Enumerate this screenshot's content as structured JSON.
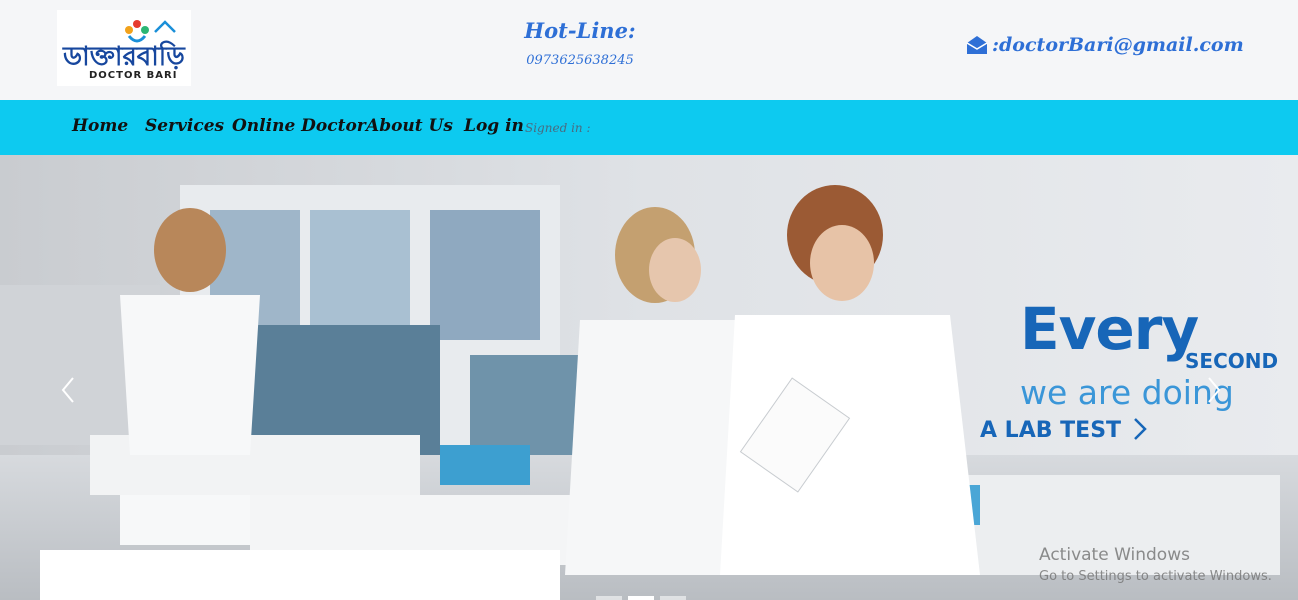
{
  "header": {
    "logo_text_bn": "ডাক্তারবাড়ি",
    "logo_text_en": "DOCTOR BARI",
    "hotline_title": "Hot-Line:",
    "hotline_number": "0973625638245",
    "email_text": ":doctorBari@gmail.com",
    "email_icon": "envelope-open-icon"
  },
  "nav": {
    "items": [
      {
        "label": "Home"
      },
      {
        "label": "Services"
      },
      {
        "label": "Online Doctor"
      },
      {
        "label": "About Us"
      },
      {
        "label": "Log in"
      }
    ],
    "signed_in": "Signed in :"
  },
  "carousel": {
    "slogan_every": "Every",
    "slogan_second": "SECOND",
    "slogan_doing": "we are doing",
    "slogan_lab": "A LAB TEST",
    "prev_icon": "chevron-left-icon",
    "next_icon": "chevron-right-icon",
    "active_indicator": 2,
    "indicator_count": 3
  },
  "watermark": {
    "line1": "Activate Windows",
    "line2": "Go to Settings to activate Windows."
  },
  "colors": {
    "nav_bg": "#0dcaf0",
    "accent_blue": "#2e6fd6",
    "slogan_blue": "#1766b8"
  }
}
